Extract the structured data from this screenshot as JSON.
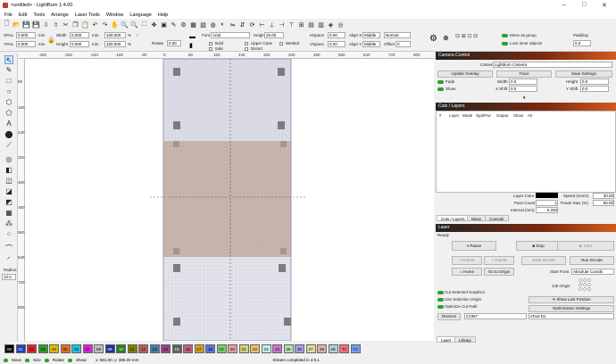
{
  "window": {
    "title": "<untitled> - LightBurn 1.4.00",
    "minimize": "–",
    "maximize": "□",
    "close": "✕"
  },
  "menu": [
    "File",
    "Edit",
    "Tools",
    "Arrange",
    "Laser Tools",
    "Window",
    "Language",
    "Help"
  ],
  "props": {
    "xpos_label": "XPos",
    "xpos": "0.000",
    "ypos_label": "YPos",
    "ypos": "0.000",
    "width_label": "Width",
    "width": "0.000",
    "height_label": "Height",
    "height": "0.000",
    "unit": "mm",
    "wpct": "100.000",
    "hpct": "100.000",
    "pct": "%",
    "rotate_label": "Rotate",
    "rotate": "0.00",
    "font_label": "Font",
    "font": "Arial",
    "height2_label": "Height",
    "height2": "25.00",
    "hspace_label": "HSpace",
    "hspace": "0.00",
    "vspace_label": "VSpace",
    "vspace": "0.00",
    "alignx_label": "Align X",
    "alignx": "Middle",
    "aligny_label": "Align Y",
    "aligny": "Middle",
    "normal": "Normal",
    "offset_label": "Offset",
    "offset": "0",
    "bold": "Bold",
    "italic": "Italic",
    "uppercase": "Upper Case",
    "distort": "Distort",
    "welded": "Welded",
    "move_group": "Move as group",
    "lock_inner": "Lock inner objects",
    "padding_label": "Padding:",
    "padding": "0.0"
  },
  "ruler_top": [
    "-400",
    "-320",
    "-240",
    "-160",
    "-80",
    "0",
    "80",
    "160",
    "240",
    "320",
    "400",
    "480",
    "560",
    "640",
    "720",
    "800"
  ],
  "ruler_left": [
    "80",
    "160",
    "240",
    "320",
    "400",
    "480",
    "560",
    "640",
    "720",
    "800"
  ],
  "left_tools": {
    "radius_label": "Radius:",
    "radius": "10.0"
  },
  "camera": {
    "title": "Camera Control",
    "camera_label": "Camera:",
    "camera": "Lightburn Camera",
    "update_overlay": "Update Overlay",
    "trace": "Trace",
    "save_settings": "Save Settings",
    "fade": "Fade",
    "show": "Show",
    "width_label": "Width",
    "width": "0.0",
    "height_label": "Height",
    "height": "0.0",
    "xshift_label": "X Shift",
    "xshift": "0.0",
    "yshift_label": "Y Shift",
    "yshift": "0.0"
  },
  "cuts": {
    "title": "Cuts / Layers",
    "columns": [
      "#",
      "Layer",
      "Mode",
      "Spd/Pwr",
      "Output",
      "Show",
      "Air"
    ],
    "layer_color_label": "Layer Color",
    "speed_label": "Speed (mm/s)",
    "speed": "30.00",
    "pass_label": "Pass Count",
    "pass": "1",
    "power_label": "Power Max (%)",
    "power": "60.00",
    "interval_label": "Interval (mm)",
    "interval": "0.200"
  },
  "tabs_mid": [
    "Cuts / Layers",
    "Move",
    "Console"
  ],
  "laser": {
    "title": "Laser",
    "status": "Ready",
    "pause": "Pause",
    "stop": "Stop",
    "start": "Start",
    "frame1": "Frame",
    "frame2": "Frame",
    "save_gcode": "Save GCode",
    "run_gcode": "Run GCode",
    "home": "Home",
    "go_origin": "Go to Origin",
    "start_from_label": "Start From:",
    "start_from": "Absolute Coords",
    "job_origin": "Job Origin",
    "cut_selected": "Cut Selected Graphics",
    "use_selection": "Use Selection Origin",
    "optimize": "Optimize Cut Path",
    "show_last": "Show Last Position",
    "opt_settings": "Optimization Settings",
    "devices": "Devices",
    "port": "COM7",
    "device": "xTool D1"
  },
  "tabs_bottom": [
    "Laser",
    "Library"
  ],
  "palette": [
    {
      "label": "00",
      "color": "#000000"
    },
    {
      "label": "01",
      "color": "#1f3fbf"
    },
    {
      "label": "02",
      "color": "#e0202a"
    },
    {
      "label": "03",
      "color": "#2ca02c"
    },
    {
      "label": "04",
      "color": "#d8c000"
    },
    {
      "label": "05",
      "color": "#e07020"
    },
    {
      "label": "06",
      "color": "#20c0e0"
    },
    {
      "label": "07",
      "color": "#e020e0"
    },
    {
      "label": "08",
      "color": "#c0c0c0"
    },
    {
      "label": "09",
      "color": "#2030a0"
    },
    {
      "label": "10",
      "color": "#208020"
    },
    {
      "label": "11",
      "color": "#808000"
    },
    {
      "label": "12",
      "color": "#b06060"
    },
    {
      "label": "13",
      "color": "#4080a0"
    },
    {
      "label": "14",
      "color": "#a04080"
    },
    {
      "label": "15",
      "color": "#606060"
    },
    {
      "label": "16",
      "color": "#c06080"
    },
    {
      "label": "17",
      "color": "#d0a020"
    },
    {
      "label": "18",
      "color": "#6070e0"
    },
    {
      "label": "19",
      "color": "#70d070"
    },
    {
      "label": "20",
      "color": "#e0a0a0"
    },
    {
      "label": "21",
      "color": "#d0d080"
    },
    {
      "label": "22",
      "color": "#f0c060"
    },
    {
      "label": "23",
      "color": "#c0f0f0"
    },
    {
      "label": "24",
      "color": "#d070d0"
    },
    {
      "label": "25",
      "color": "#b0e0b0"
    },
    {
      "label": "26",
      "color": "#a0a0e0"
    },
    {
      "label": "27",
      "color": "#e0e0a0"
    },
    {
      "label": "28",
      "color": "#e0b0b0"
    },
    {
      "label": "29",
      "color": "#b0d0e0"
    },
    {
      "label": "T1",
      "color": "#f07070"
    },
    {
      "label": "T2",
      "color": "#70a0f0"
    }
  ],
  "status": {
    "move": "Move",
    "size": "Size",
    "rotate": "Rotate",
    "shear": "Shear",
    "coords": "x: 581.00, y: 385.00 mm",
    "message": "Stream completed in 4:0.1"
  }
}
